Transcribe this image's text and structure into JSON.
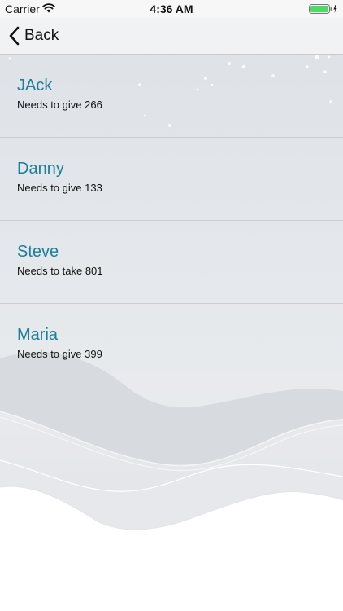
{
  "status_bar": {
    "carrier": "Carrier",
    "time": "4:36 AM",
    "wifi_icon": "wifi-icon",
    "battery_icon": "battery-charging-icon"
  },
  "nav": {
    "back_label": "Back",
    "back_icon": "chevron-left-icon"
  },
  "people": [
    {
      "name": "JAck",
      "detail": "Needs to give 266"
    },
    {
      "name": "Danny",
      "detail": "Needs to give 133"
    },
    {
      "name": "Steve",
      "detail": "Needs to take 801"
    },
    {
      "name": "Maria",
      "detail": "Needs to give 399"
    }
  ],
  "colors": {
    "name_text": "#1b7f99",
    "battery_fill": "#4cd964"
  }
}
